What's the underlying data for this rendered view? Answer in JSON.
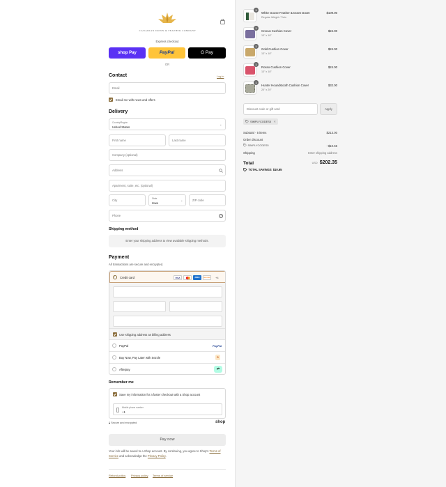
{
  "brand": {
    "name": "CANADIAN DOWN & FEATHER COMPANY"
  },
  "express": {
    "title": "Express checkout",
    "shop_pay": "shop Pay",
    "paypal": "PayPal",
    "gpay": "G Pay",
    "or": "OR"
  },
  "contact": {
    "title": "Contact",
    "login": "Log in",
    "email_placeholder": "Email",
    "news_label": "Email me with news and offers"
  },
  "delivery": {
    "title": "Delivery",
    "country_label": "Country/Region",
    "country_value": "United States",
    "first_name": "First name",
    "last_name": "Last name",
    "company": "Company (optional)",
    "address": "Address",
    "apartment": "Apartment, suite, etc. (optional)",
    "city": "City",
    "state_label": "State",
    "state_value": "Iowa",
    "zip": "ZIP code",
    "phone": "Phone"
  },
  "shipping_method": {
    "title": "Shipping method",
    "message": "Enter your shipping address to view available shipping methods."
  },
  "payment": {
    "title": "Payment",
    "subtitle": "All transactions are secure and encrypted.",
    "credit_card": "Credit card",
    "more_cards": "+4",
    "card_brands": [
      "VISA",
      "MC",
      "AMEX",
      "DISCOVER"
    ],
    "billing_label": "Use shipping address as billing address",
    "options": [
      {
        "label": "PayPal",
        "badge": "PayPal"
      },
      {
        "label": "Buy Now, Pay Later with Sezzle",
        "badge": "S"
      },
      {
        "label": "Afterpay",
        "badge": "⇄"
      }
    ]
  },
  "remember": {
    "title": "Remember me",
    "save_label": "Save my information for a faster checkout with a Shop account",
    "mobile_label": "Mobile phone number",
    "mobile_value": "+1",
    "secure": "Secure and encrypted",
    "shop": "shop"
  },
  "pay_now": "Pay now",
  "legal": {
    "text1": "Your info will be saved to a Shop account. By continuing, you agree to Shop's",
    "terms": "Terms of Service",
    "text2": "and acknowledge the",
    "privacy": "Privacy Policy",
    "end": "."
  },
  "footer_links": [
    "Refund policy",
    "Privacy policy",
    "Terms of service"
  ],
  "cart": {
    "items": [
      {
        "name": "White Goose Feather & Down Duvet",
        "variant": "Regular Weight / Twin",
        "price": "$109.00",
        "qty": "1",
        "color": "#e9e6df",
        "accent": "#2f5b3a"
      },
      {
        "name": "Crocus Cushion Cover",
        "variant": "13\" x 18\"",
        "price": "$24.00",
        "qty": "1",
        "color": "#7a6f9e",
        "accent": "#5d5384"
      },
      {
        "name": "Gold Cushion Cover",
        "variant": "13\" x 18\"",
        "price": "$24.00",
        "qty": "1",
        "color": "#c9a86a",
        "accent": "#b08f52"
      },
      {
        "name": "Rosso Cushion Cover",
        "variant": "13\" x 18\"",
        "price": "$24.00",
        "qty": "1",
        "color": "#d9536b",
        "accent": "#c03c55"
      },
      {
        "name": "Hunter Houndstooth Cushion Cover",
        "variant": "20\" x 20\"",
        "price": "$32.00",
        "qty": "1",
        "color": "#a8a99a",
        "accent": "#6e7062"
      }
    ],
    "discount_placeholder": "Discount code or gift card",
    "apply": "Apply",
    "code": "SIMPLYCODES5",
    "subtotal_label": "Subtotal · 5 items",
    "subtotal_value": "$213.00",
    "order_discount_label": "Order discount",
    "order_discount_code": "SIMPLYCODES5",
    "order_discount_value": "−$10.65",
    "shipping_label": "Shipping",
    "shipping_value": "Enter shipping address",
    "total_label": "Total",
    "currency": "USD",
    "total_value": "$202.35",
    "savings_label": "TOTAL SAVINGS",
    "savings_value": "$10.65"
  }
}
